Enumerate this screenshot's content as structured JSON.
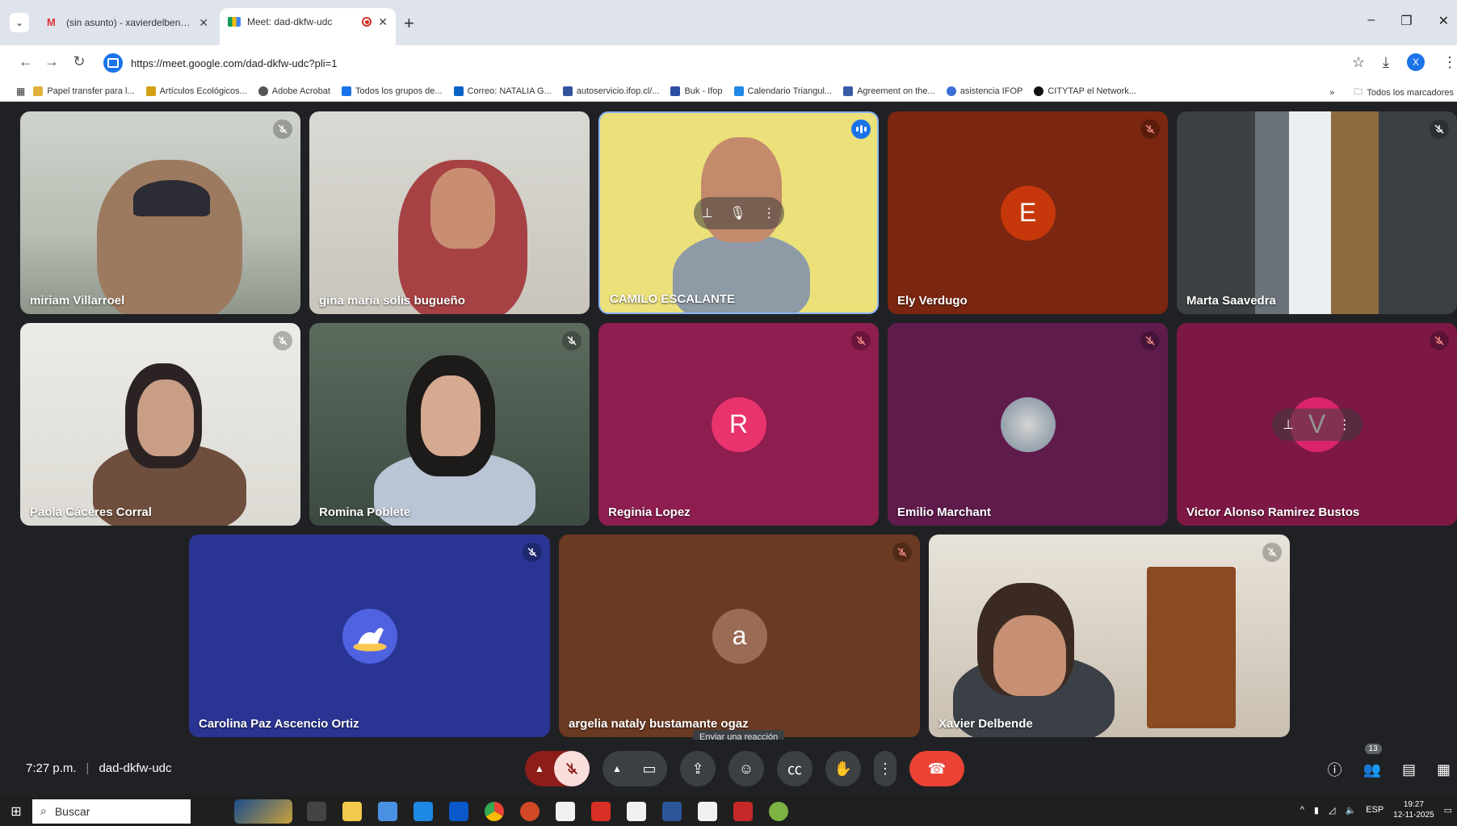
{
  "browser": {
    "tabs": [
      {
        "title": "(sin asunto) - xavierdelbende@",
        "favicon": "gmail-icon",
        "active": false
      },
      {
        "title": "Meet: dad-dkfw-udc",
        "favicon": "meet-icon",
        "active": true,
        "recording": true
      }
    ],
    "url": "https://meet.google.com/dad-dkfw-udc?pli=1",
    "profile_initial": "X",
    "bookmarks": [
      {
        "label": "Papel transfer para l...",
        "color": "#e0b23d"
      },
      {
        "label": "Artículos Ecológicos...",
        "color": "#d4a017"
      },
      {
        "label": "Adobe Acrobat",
        "color": "#555555"
      },
      {
        "label": "Todos los grupos de...",
        "color": "#1a73e8"
      },
      {
        "label": "Correo: NATALIA G...",
        "color": "#0a64c8"
      },
      {
        "label": "autoservicio.ifop.cl/...",
        "color": "#33539e"
      },
      {
        "label": "Buk - Ifop",
        "color": "#2d4fa1"
      },
      {
        "label": "Calendario Triangul...",
        "color": "#1e88e5"
      },
      {
        "label": "Agreement on the...",
        "color": "#3b5ba5"
      },
      {
        "label": "asistencia IFOP",
        "color": "#3b6fd6"
      },
      {
        "label": "CITYTAP el Network...",
        "color": "#111111"
      }
    ],
    "bookmarks_overflow": "»",
    "all_bookmarks": "Todos los marcadores"
  },
  "participants": [
    {
      "name": "miriam Villarroel",
      "type": "video",
      "muted": true
    },
    {
      "name": "gina maria solis bugueño",
      "type": "video",
      "muted": false
    },
    {
      "name": "CAMILO ESCALANTE",
      "type": "video",
      "muted": false,
      "speaking": true
    },
    {
      "name": "Ely Verdugo",
      "type": "avatar",
      "initial": "E",
      "bg": "#7a2610",
      "avatar_bg": "#c6380b",
      "muted": true
    },
    {
      "name": "Marta Saavedra",
      "type": "video",
      "muted": true
    },
    {
      "name": "Paola Cáceres Corral",
      "type": "video",
      "muted": true
    },
    {
      "name": "Romina Poblete",
      "type": "video",
      "muted": true
    },
    {
      "name": "Reginia Lopez",
      "type": "avatar",
      "initial": "R",
      "bg": "#8e1d50",
      "avatar_bg": "#e8336d",
      "muted": true
    },
    {
      "name": "Emilio Marchant",
      "type": "avatar",
      "initial": "",
      "bg": "#5f1b4c",
      "avatar_bg": "#b5b5b5",
      "muted": true
    },
    {
      "name": "Victor Alonso Ramirez Bustos",
      "type": "avatar",
      "initial": "V",
      "bg": "#7d1844",
      "avatar_bg": "#d9246a",
      "muted": true
    },
    {
      "name": "Carolina Paz Ascencio Ortiz",
      "type": "avatar",
      "initial": "",
      "bg": "#2a3593",
      "avatar_bg": "#4f62e0",
      "muted": true
    },
    {
      "name": "argelia nataly bustamante ogaz",
      "type": "avatar",
      "initial": "a",
      "bg": "#6b3a22",
      "avatar_bg": "#9a6b55",
      "muted": true
    },
    {
      "name": "Xavier Delbende",
      "type": "video",
      "muted": true
    }
  ],
  "call": {
    "time": "7:27 p.m.",
    "meeting_code": "dad-dkfw-udc",
    "tooltip": "Enviar una reacción",
    "people_count": "13"
  },
  "taskbar": {
    "search_label": "Buscar",
    "language": "ESP",
    "time": "19:27",
    "date": "12-11-2025"
  }
}
